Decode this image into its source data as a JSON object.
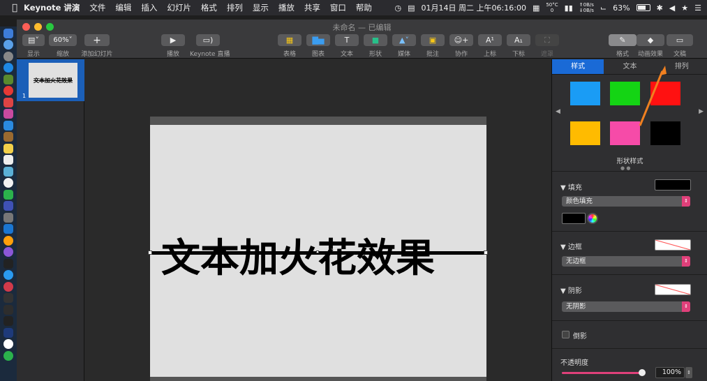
{
  "menubar": {
    "app_name": "Keynote 讲演",
    "items": [
      "文件",
      "编辑",
      "插入",
      "幻灯片",
      "格式",
      "排列",
      "显示",
      "播放",
      "共享",
      "窗口",
      "帮助"
    ],
    "datetime": "01月14日 周二 上午06:16:00",
    "temp": "50°C",
    "temp_sub": "0",
    "net_up": "0B/s",
    "net_down": "0B/s",
    "battery": "63%"
  },
  "window": {
    "title": "未命名 — 已编辑",
    "toolbar": {
      "view_label": "显示",
      "zoom_value": "60%",
      "zoom_label": "缩放",
      "add_slide_label": "添加幻灯片",
      "play_label": "播放",
      "live_label": "Keynote 直播",
      "table_label": "表格",
      "chart_label": "图表",
      "text_label": "文本",
      "shape_label": "形状",
      "media_label": "媒体",
      "comment_label": "批注",
      "collab_label": "协作",
      "sup_label": "上标",
      "sub_label": "下标",
      "mask_label": "遮罩",
      "format_label": "格式",
      "animate_label": "动画效果",
      "document_label": "文稿"
    }
  },
  "navigator": {
    "slide_number": "1",
    "thumb_text": "文本加火花效果"
  },
  "slide": {
    "text": "文本加火花效果"
  },
  "inspector": {
    "tabs": [
      "样式",
      "文本",
      "排列"
    ],
    "active_tab": 0,
    "swatch_colors": [
      "#1a9cf5",
      "#14d414",
      "#ff1111",
      "#ffbb00",
      "#f64ba8",
      "#000000"
    ],
    "shape_styles_label": "形状样式",
    "fill_label": "填充",
    "fill_type": "颜色填充",
    "border_label": "边框",
    "border_type": "无边框",
    "shadow_label": "阴影",
    "shadow_type": "无阴影",
    "reflection_label": "倒影",
    "opacity_label": "不透明度",
    "opacity_value": "100%",
    "opacity_fraction": 1.0
  },
  "colors": {
    "accent": "#1a6ad6",
    "popup_arrow": "#e0407a",
    "annotation_arrow": "#f08020"
  }
}
